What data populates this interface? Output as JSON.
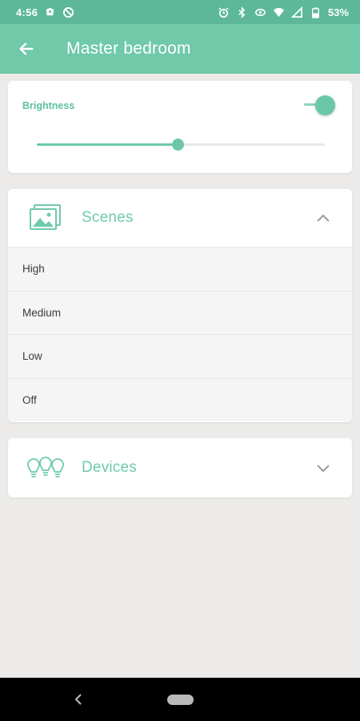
{
  "status_bar": {
    "time": "4:56",
    "battery": "53%",
    "left_icons": [
      "notification-icon",
      "no-sync-icon"
    ],
    "right_icons": [
      "alarm-icon",
      "bluetooth-icon",
      "vibrate-icon",
      "wifi-icon",
      "signal-icon",
      "battery-icon"
    ]
  },
  "app_bar": {
    "title": "Master bedroom",
    "back_icon": "arrow-left-icon"
  },
  "brightness": {
    "label": "Brightness",
    "toggle_on": true,
    "level": 0.49
  },
  "scenes": {
    "title": "Scenes",
    "expanded": true,
    "items": [
      {
        "label": "High"
      },
      {
        "label": "Medium"
      },
      {
        "label": "Low"
      },
      {
        "label": "Off"
      }
    ]
  },
  "devices": {
    "title": "Devices",
    "expanded": false
  },
  "colors": {
    "status_bar": "#5cb898",
    "app_bar": "#70c9a9",
    "accent": "#6cc7a6",
    "background": "#ecebe9"
  }
}
